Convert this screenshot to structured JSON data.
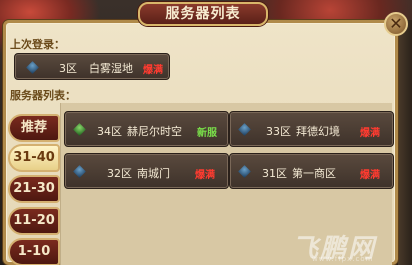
{
  "window": {
    "title": "服务器列表",
    "close_glyph": "✕"
  },
  "last_login": {
    "label": "上次登录：",
    "server": {
      "zone": "3区",
      "name": "白雾湿地",
      "status": "爆满",
      "icon": "gem-blue-icon"
    }
  },
  "server_list": {
    "label": "服务器列表：",
    "servers": [
      {
        "zone": "34区",
        "name": "赫尼尔时空",
        "status": "新服",
        "status_type": "new",
        "icon": "gem-green-icon"
      },
      {
        "zone": "33区",
        "name": "拜德幻境",
        "status": "爆满",
        "status_type": "full",
        "icon": "gem-blue-icon"
      },
      {
        "zone": "32区",
        "name": "南城门",
        "status": "爆满",
        "status_type": "full",
        "icon": "gem-blue-icon"
      },
      {
        "zone": "31区",
        "name": "第一商区",
        "status": "爆满",
        "status_type": "full",
        "icon": "gem-blue-icon"
      }
    ]
  },
  "tabs": [
    {
      "label": "推荐",
      "active": false
    },
    {
      "label": "31-40",
      "active": true
    },
    {
      "label": "21-30",
      "active": false
    },
    {
      "label": "11-20",
      "active": false
    },
    {
      "label": "1-10",
      "active": false
    }
  ],
  "watermark": {
    "text": "飞鹏网",
    "url": "www.ffpx.com"
  },
  "colors": {
    "status_full": "#ff3b30",
    "status_new": "#7ae04a",
    "panel_bg": "#efe4c8",
    "card_bg": "#4a3c32"
  }
}
